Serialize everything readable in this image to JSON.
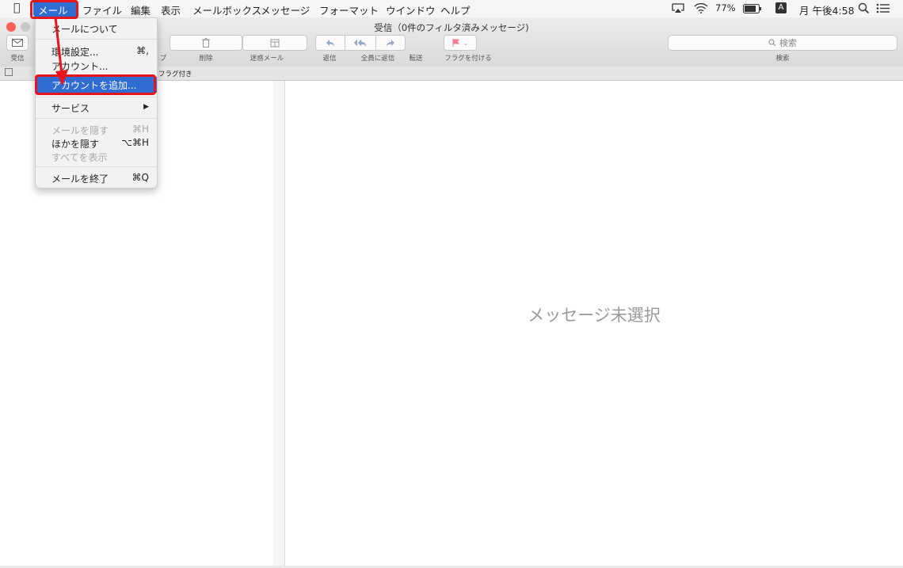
{
  "menubar": {
    "apple_icon": "apple-logo-icon",
    "items": [
      "メール",
      "ファイル",
      "編集",
      "表示",
      "メールボックス",
      "メッセージ",
      "フォーマット",
      "ウインドウ",
      "ヘルプ"
    ],
    "status": {
      "battery": "77%",
      "input_mode": "A",
      "clock": "月 午後4:58"
    }
  },
  "window": {
    "title": "受信（0件のフィルタ済みメッセージ)"
  },
  "toolbar": {
    "get_mail": "受信",
    "archive": "ブ",
    "delete": "削除",
    "junk": "迷惑メール",
    "reply": "返信",
    "reply_all": "全員に返信",
    "forward": "転送",
    "flag": "フラグを付ける",
    "search_placeholder": "検索",
    "search_label": "検索"
  },
  "favorites_bar": {
    "visible_text": "フラグ付き"
  },
  "mail_menu": {
    "items": [
      {
        "label": "メールについて",
        "shortcut": ""
      },
      {
        "label": "環境設定...",
        "shortcut": "⌘,"
      },
      {
        "label": "アカウント...",
        "shortcut": ""
      },
      {
        "label": "アカウントを追加...",
        "shortcut": ""
      },
      {
        "label": "サービス",
        "shortcut": "▶"
      },
      {
        "label": "メールを隠す",
        "shortcut": "⌘H"
      },
      {
        "label": "ほかを隠す",
        "shortcut": "⌥⌘H"
      },
      {
        "label": "すべてを表示",
        "shortcut": ""
      },
      {
        "label": "メールを終了",
        "shortcut": "⌘Q"
      }
    ]
  },
  "content": {
    "empty_message": "メッセージ未選択"
  },
  "colors": {
    "highlight": "#2f6dd3",
    "annotation": "#e8141c",
    "close": "#fc5f57",
    "minimize": "#fdbc2e",
    "zoom": "#c8c8c8"
  }
}
